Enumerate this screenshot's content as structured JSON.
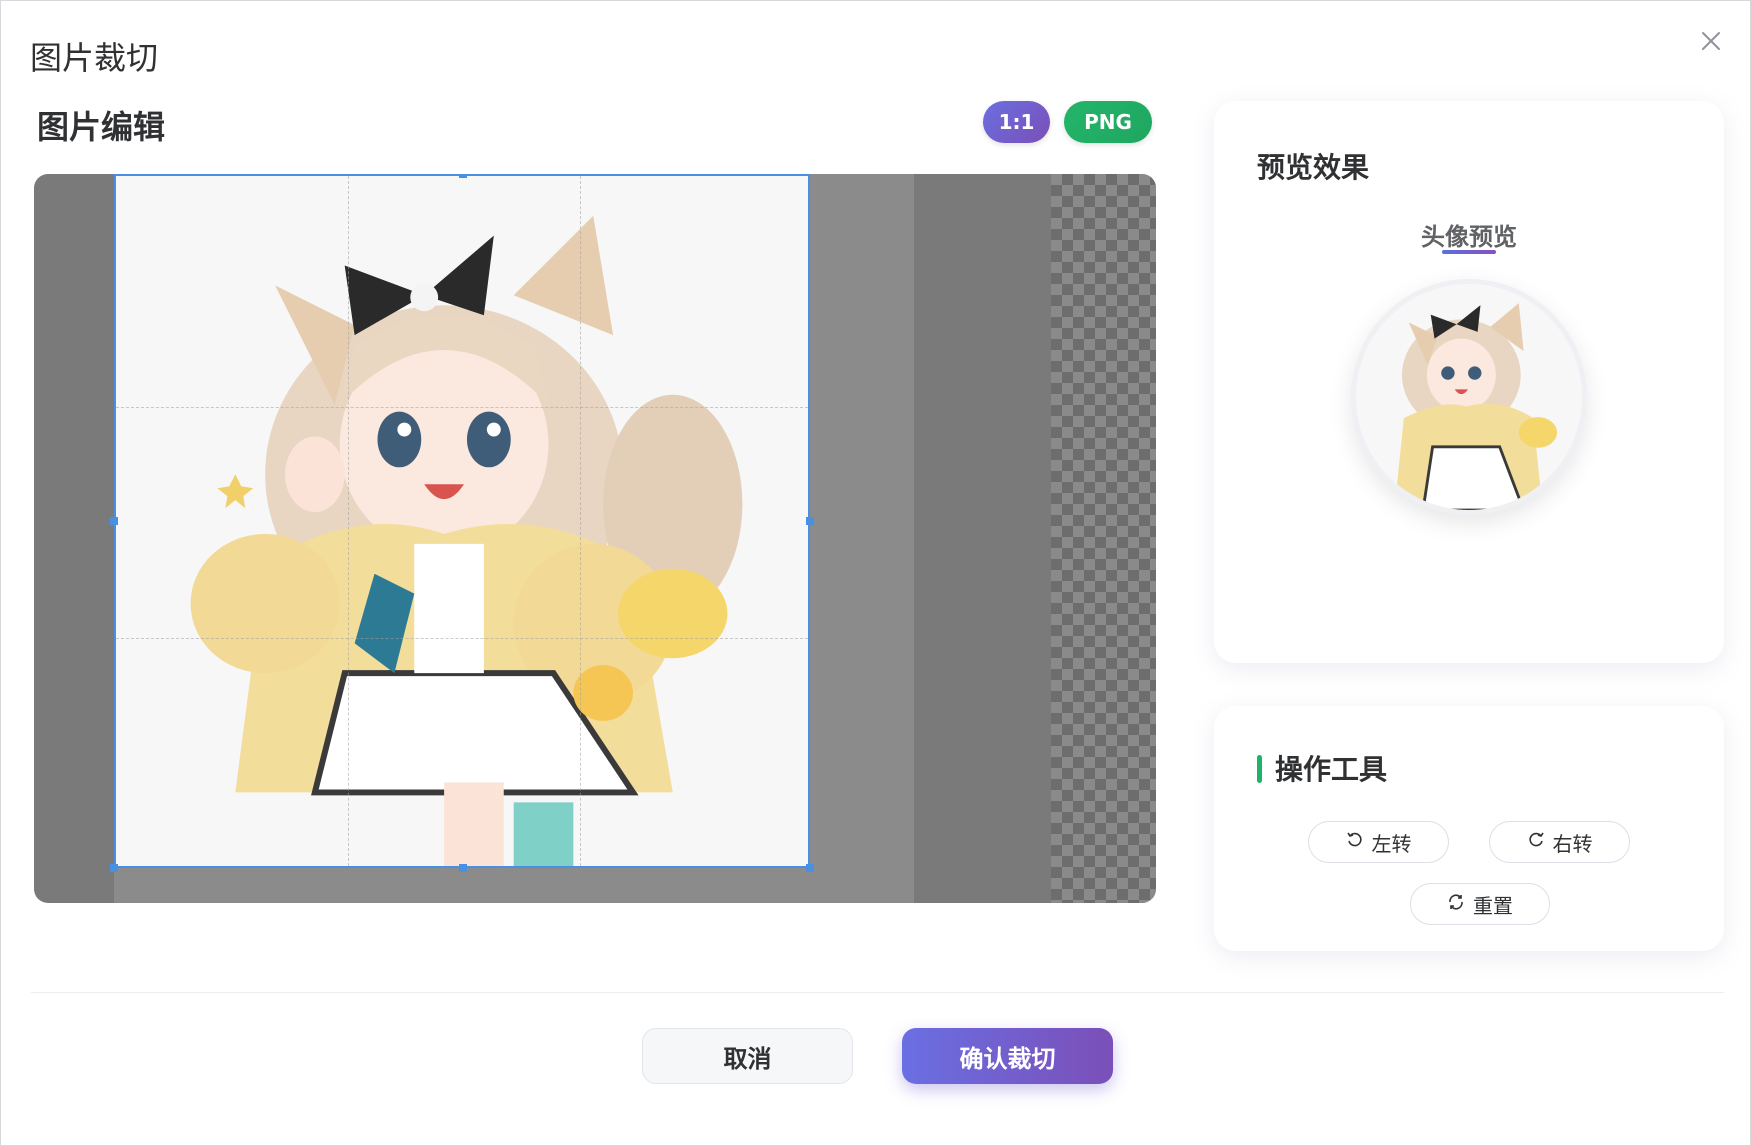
{
  "dialog": {
    "title": "图片裁切"
  },
  "editor": {
    "title": "图片编辑",
    "ratio_badge": "1:1",
    "format_badge": "PNG",
    "image_alt": "anime girl with fox ears and yellow hoodie"
  },
  "preview": {
    "title": "预览效果",
    "tab_label": "头像预览"
  },
  "tools": {
    "title": "操作工具",
    "rotate_left": "左转",
    "rotate_right": "右转",
    "reset": "重置"
  },
  "footer": {
    "cancel": "取消",
    "confirm": "确认裁切"
  },
  "icons": {
    "close": "close-icon",
    "rotate_left": "rotate-left-icon",
    "rotate_right": "rotate-right-icon",
    "reset": "refresh-icon"
  },
  "colors": {
    "accent_gradient_start": "#6a6fe3",
    "accent_gradient_end": "#7b4fb8",
    "format_badge": "#23b56a",
    "crop_border": "#4a90e2",
    "tools_accent": "#1fb36a"
  }
}
